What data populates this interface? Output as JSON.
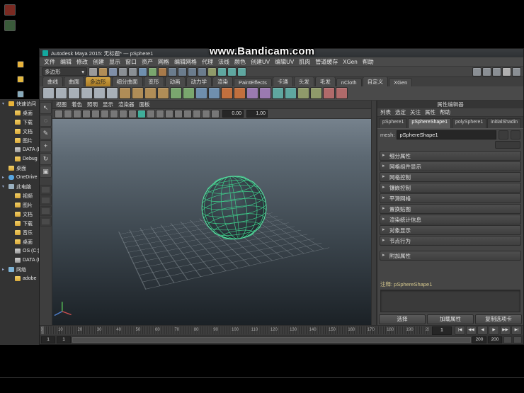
{
  "watermark": {
    "text": "www.Bandicam.com"
  },
  "desktop": {
    "icons": [
      {
        "name": "recycle-bin-icon",
        "color": "#7a2a22"
      },
      {
        "name": "app-shortcut-icon",
        "color": "#3a5a3a"
      }
    ]
  },
  "explorer": {
    "toolbar_icons": [
      {
        "name": "star-icon",
        "color": "#e8b33a"
      },
      {
        "name": "folder-icon",
        "color": "#e3b83e"
      },
      {
        "name": "pin-icon",
        "color": "#88aabb"
      },
      {
        "name": "history-icon",
        "color": "#aa6666"
      }
    ],
    "items": [
      {
        "label": "快速访问",
        "icon": "star",
        "depth": 0,
        "expander": "▾",
        "name": "tree-item-quick-access"
      },
      {
        "label": "桌面",
        "icon": "folder",
        "depth": 1,
        "name": "tree-item-desktop"
      },
      {
        "label": "下载",
        "icon": "folder",
        "depth": 1,
        "name": "tree-item-downloads"
      },
      {
        "label": "文档",
        "icon": "folder",
        "depth": 1,
        "name": "tree-item-documents"
      },
      {
        "label": "图片",
        "icon": "folder",
        "depth": 1,
        "name": "tree-item-pictures"
      },
      {
        "label": "DATA (D:)",
        "icon": "drive",
        "depth": 1,
        "name": "tree-item-data-drive"
      },
      {
        "label": "Debug",
        "icon": "folder",
        "depth": 1,
        "name": "tree-item-debug"
      },
      {
        "label": "桌面",
        "icon": "folder",
        "depth": 0,
        "name": "tree-item-desktop-root"
      },
      {
        "label": "OneDrive",
        "icon": "cloud",
        "depth": 0,
        "expander": "▸",
        "name": "tree-item-onedrive"
      },
      {
        "label": "此电脑",
        "icon": "pc",
        "depth": 0,
        "expander": "▾",
        "name": "tree-item-this-pc"
      },
      {
        "label": "视频",
        "icon": "folder",
        "depth": 1,
        "name": "tree-item-videos"
      },
      {
        "label": "图片",
        "icon": "folder",
        "depth": 1,
        "name": "tree-item-pictures-2"
      },
      {
        "label": "文档",
        "icon": "folder",
        "depth": 1,
        "name": "tree-item-documents-2"
      },
      {
        "label": "下载",
        "icon": "folder",
        "depth": 1,
        "name": "tree-item-downloads-2"
      },
      {
        "label": "音乐",
        "icon": "folder",
        "depth": 1,
        "name": "tree-item-music"
      },
      {
        "label": "桌面",
        "icon": "folder",
        "depth": 1,
        "name": "tree-item-desktop-2"
      },
      {
        "label": "OS (C:)",
        "icon": "drive",
        "depth": 1,
        "name": "tree-item-os-c"
      },
      {
        "label": "DATA (D:)",
        "icon": "drive",
        "depth": 1,
        "name": "tree-item-data-d"
      },
      {
        "label": "网络",
        "icon": "net",
        "depth": 0,
        "expander": "▸",
        "name": "tree-item-network"
      },
      {
        "label": "adobe",
        "icon": "folder",
        "depth": 1,
        "name": "tree-item-adobe"
      }
    ]
  },
  "maya": {
    "titlebar": {
      "title": "Autodesk Maya 2015: 无标题* --- pSphere1"
    },
    "menu_items": [
      "文件",
      "编辑",
      "修改",
      "创建",
      "显示",
      "窗口",
      "资产",
      "网格",
      "编辑网格",
      "代理",
      "法线",
      "颜色",
      "创建UV",
      "编辑UV",
      "肌肉",
      "管道缓存",
      "XGen",
      "帮助"
    ],
    "statusline": {
      "menuset": "多边形",
      "dropdown_arrow": "▾",
      "icons": [
        {
          "name": "new-scene-icon",
          "color": "#9a9a9a"
        },
        {
          "name": "open-scene-icon",
          "color": "#b08d57"
        },
        {
          "name": "save-scene-icon",
          "color": "#7f8fa8"
        },
        {
          "name": "undo-icon",
          "color": "#8a8f94"
        },
        {
          "name": "redo-icon",
          "color": "#8a8f94"
        },
        {
          "name": "select-hierarchy-icon",
          "color": "#6f8fae"
        },
        {
          "name": "select-object-icon",
          "color": "#7aa66e"
        },
        {
          "name": "select-component-icon",
          "color": "#a87a4a"
        },
        {
          "name": "snap-grid-icon",
          "color": "#6b7c8d"
        },
        {
          "name": "snap-curve-icon",
          "color": "#6b7c8d"
        },
        {
          "name": "snap-point-icon",
          "color": "#6b7c8d"
        },
        {
          "name": "snap-plane-icon",
          "color": "#6b7c8d"
        },
        {
          "name": "history-icon",
          "color": "#8f9a6a"
        },
        {
          "name": "render-view-icon",
          "color": "#5fa7a0"
        },
        {
          "name": "render-frame-icon",
          "color": "#5fa7a0"
        },
        {
          "name": "render-settings-icon",
          "color": "#5fa7a0"
        }
      ],
      "right_icons": [
        {
          "name": "sidebar-toggle-icon",
          "color": "#8a8f94"
        },
        {
          "name": "channel-box-icon",
          "color": "#8a8f94"
        },
        {
          "name": "layer-editor-icon",
          "color": "#8a8f94"
        },
        {
          "name": "attribute-editor-icon",
          "color": "#b0b0b0"
        },
        {
          "name": "tool-settings-icon",
          "color": "#8a8f94"
        }
      ]
    },
    "shelf": {
      "tabs": [
        {
          "label": "曲线",
          "name": "shelf-tab-curves"
        },
        {
          "label": "曲面",
          "name": "shelf-tab-surfaces"
        },
        {
          "label": "多边形",
          "name": "shelf-tab-polygons",
          "active": true
        },
        {
          "label": "细分曲面",
          "name": "shelf-tab-subdivs"
        },
        {
          "label": "变形",
          "name": "shelf-tab-deformation"
        },
        {
          "label": "动画",
          "name": "shelf-tab-animation"
        },
        {
          "label": "动力学",
          "name": "shelf-tab-dynamics"
        },
        {
          "label": "渲染",
          "name": "shelf-tab-rendering"
        },
        {
          "label": "PaintEffects",
          "name": "shelf-tab-painteffects"
        },
        {
          "label": "卡通",
          "name": "shelf-tab-toon"
        },
        {
          "label": "头发",
          "name": "shelf-tab-hair"
        },
        {
          "label": "毛发",
          "name": "shelf-tab-fur"
        },
        {
          "label": "nCloth",
          "name": "shelf-tab-ncloth"
        },
        {
          "label": "自定义",
          "name": "shelf-tab-custom"
        },
        {
          "label": "XGen",
          "name": "shelf-tab-xgen"
        }
      ],
      "icons": [
        {
          "name": "poly-sphere-icon",
          "color": "#a8b0b8"
        },
        {
          "name": "poly-cube-icon",
          "color": "#a8b0b8"
        },
        {
          "name": "poly-cylinder-icon",
          "color": "#a8b0b8"
        },
        {
          "name": "poly-cone-icon",
          "color": "#a8b0b8"
        },
        {
          "name": "poly-plane-icon",
          "color": "#a8b0b8"
        },
        {
          "name": "poly-torus-icon",
          "color": "#a8b0b8"
        },
        {
          "name": "poly-prism-icon",
          "color": "#b08d57"
        },
        {
          "name": "poly-pyramid-icon",
          "color": "#b08d57"
        },
        {
          "name": "poly-pipe-icon",
          "color": "#b08d57"
        },
        {
          "name": "poly-helix-icon",
          "color": "#b08d57"
        },
        {
          "name": "poly-soccer-icon",
          "color": "#7aa66e"
        },
        {
          "name": "poly-platonic-icon",
          "color": "#7aa66e"
        },
        {
          "name": "combine-icon",
          "color": "#6f8fae"
        },
        {
          "name": "separate-icon",
          "color": "#6f8fae"
        },
        {
          "name": "extrude-icon",
          "color": "#c2703e"
        },
        {
          "name": "bridge-icon",
          "color": "#c2703e"
        },
        {
          "name": "append-icon",
          "color": "#9a7ab0"
        },
        {
          "name": "split-icon",
          "color": "#9a7ab0"
        },
        {
          "name": "insert-edge-loop-icon",
          "color": "#5fa7a0"
        },
        {
          "name": "bevel-icon",
          "color": "#5fa7a0"
        },
        {
          "name": "smooth-icon",
          "color": "#8f9a6a"
        },
        {
          "name": "mirror-icon",
          "color": "#8f9a6a"
        },
        {
          "name": "boolean-icon",
          "color": "#b06a6a"
        },
        {
          "name": "reduce-icon",
          "color": "#b06a6a"
        }
      ]
    },
    "toolbox": {
      "tools": [
        {
          "name": "select-tool-icon",
          "glyph": "↖"
        },
        {
          "name": "lasso-tool-icon",
          "glyph": "◌"
        },
        {
          "name": "paint-select-tool-icon",
          "glyph": "✎"
        },
        {
          "name": "move-tool-icon",
          "glyph": "+"
        },
        {
          "name": "rotate-tool-icon",
          "glyph": "↻"
        },
        {
          "name": "scale-tool-icon",
          "glyph": "▣"
        }
      ]
    },
    "viewport": {
      "panel_menu": [
        "视图",
        "着色",
        "照明",
        "显示",
        "渲染器",
        "面板"
      ],
      "toolbar_icons": [
        {
          "name": "camera-lock-icon",
          "color": "#777777"
        },
        {
          "name": "grid-toggle-icon",
          "color": "#777777"
        },
        {
          "name": "film-gate-icon",
          "color": "#777777"
        },
        {
          "name": "resolution-gate-icon",
          "color": "#777777"
        },
        {
          "name": "gate-mask-icon",
          "color": "#777777"
        },
        {
          "name": "field-chart-icon",
          "color": "#777777"
        },
        {
          "name": "safe-action-icon",
          "color": "#777777"
        },
        {
          "name": "safe-title-icon",
          "color": "#777777"
        },
        {
          "name": "wireframe-icon",
          "color": "#777777"
        },
        {
          "name": "shaded-icon",
          "color": "#3fae9a"
        },
        {
          "name": "textured-icon",
          "color": "#777777"
        },
        {
          "name": "lights-icon",
          "color": "#777777"
        },
        {
          "name": "shadows-icon",
          "color": "#777777"
        },
        {
          "name": "screen-ao-icon",
          "color": "#777777"
        },
        {
          "name": "motion-blur-icon",
          "color": "#777777"
        },
        {
          "name": "multisampling-icon",
          "color": "#777777"
        },
        {
          "name": "xray-icon",
          "color": "#777777"
        },
        {
          "name": "isolate-select-icon",
          "color": "#777777"
        }
      ],
      "exposure_value": "0.00",
      "gamma_value": "1.00",
      "scene_object": "pSphere1"
    },
    "attribute_editor": {
      "panel_title": "属性编辑器",
      "menu_items": [
        "列表",
        "选定",
        "关注",
        "属性",
        "帮助"
      ],
      "tabs": [
        {
          "label": "pSphere1",
          "name": "ae-tab-psphere1"
        },
        {
          "label": "pSphereShape1",
          "name": "ae-tab-psphereshape1",
          "active": true
        },
        {
          "label": "polySphere1",
          "name": "ae-tab-polysphere1"
        },
        {
          "label": "initialShadin",
          "name": "ae-tab-initialshadinggroup"
        }
      ],
      "mesh_field": {
        "label": "mesh:",
        "value": "pSphereShape1"
      },
      "sections": [
        {
          "label": "细分属性",
          "name": "section-tessellation"
        },
        {
          "label": "网格组件显示",
          "name": "section-mesh-component-display"
        },
        {
          "label": "网格控制",
          "name": "section-mesh-controls"
        },
        {
          "label": "镶嵌控制",
          "name": "section-tessellation-controls"
        },
        {
          "label": "平滑网格",
          "name": "section-smooth-mesh"
        },
        {
          "label": "置换贴图",
          "name": "section-displacement-map"
        },
        {
          "label": "渲染统计信息",
          "name": "section-render-stats"
        },
        {
          "label": "对象显示",
          "name": "section-object-display"
        },
        {
          "label": "节点行为",
          "name": "section-node-behavior"
        },
        {
          "label": "附加属性",
          "name": "section-extra-attributes",
          "gap": true
        }
      ],
      "section_arrow": "▸",
      "notes_label": "注释: pSphereShape1",
      "buttons": [
        {
          "label": "选择",
          "name": "select-button"
        },
        {
          "label": "加载属性",
          "name": "load-attributes-button"
        },
        {
          "label": "复制选项卡",
          "name": "copy-tab-button"
        }
      ]
    },
    "timeline": {
      "start": 0,
      "end": 200,
      "label_step": 10,
      "current_frame": "1"
    },
    "range_slider": {
      "fields": [
        "1",
        "1",
        "200",
        "200"
      ]
    },
    "transport": [
      {
        "name": "go-to-start-button",
        "glyph": "|◀"
      },
      {
        "name": "step-back-button",
        "glyph": "◀◀"
      },
      {
        "name": "play-backwards-button",
        "glyph": "◀"
      },
      {
        "name": "play-forwards-button",
        "glyph": "▶"
      },
      {
        "name": "step-forward-button",
        "glyph": "▶▶"
      },
      {
        "name": "go-to-end-button",
        "glyph": "▶|"
      }
    ]
  }
}
